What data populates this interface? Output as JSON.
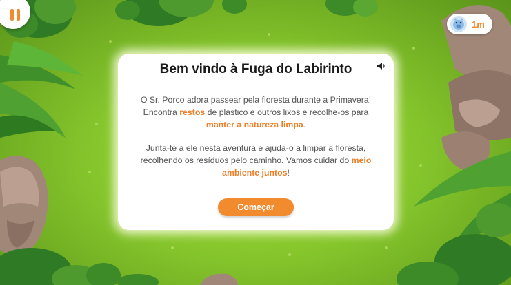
{
  "hud": {
    "pause_icon": "pause-icon",
    "distance_icon": "piggy-character-icon",
    "distance": "1m"
  },
  "modal": {
    "title": "Bem vindo à Fuga do Labirinto",
    "sound_icon": "speaker-icon",
    "paragraph1": {
      "t1": "O Sr. Porco adora passear pela floresta durante a Primavera! Encontra ",
      "h1": "restos",
      "t2": " de plástico e outros lixos e recolhe-os para ",
      "h2": "manter a natureza limpa",
      "t3": "."
    },
    "paragraph2": {
      "t1": "Junta-te a ele nesta aventura e ajuda-o a limpar a floresta, recolhendo os resíduos pelo caminho. Vamos cuidar do ",
      "h1": "meio ambiente juntos",
      "t2": "!"
    },
    "start_button": "Começar"
  },
  "colors": {
    "accent": "#f28a2e",
    "highlight": "#ef7d25",
    "grass": "#86c62c"
  }
}
